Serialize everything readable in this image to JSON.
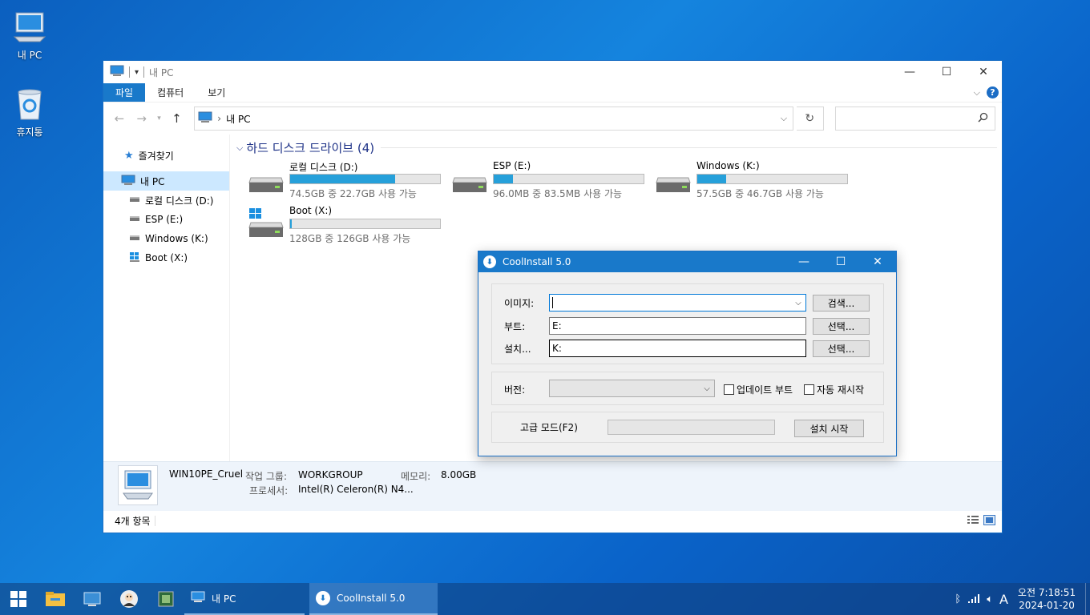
{
  "desktop": {
    "icons": [
      {
        "label": "내 PC",
        "icon": "computer-icon"
      },
      {
        "label": "휴지통",
        "icon": "recycle-bin-icon"
      }
    ]
  },
  "explorer": {
    "title": "내 PC",
    "ribbon_tabs": [
      "파일",
      "컴퓨터",
      "보기"
    ],
    "address": "내 PC",
    "search_placeholder": "",
    "nav": {
      "favorites": "즐겨찾기",
      "this_pc": "내 PC",
      "drives": [
        "로컬 디스크 (D:)",
        "ESP (E:)",
        "Windows (K:)",
        "Boot (X:)"
      ]
    },
    "group_title": "하드 디스크 드라이브 (4)",
    "drives": [
      {
        "name": "로컬 디스크 (D:)",
        "free_text": "74.5GB 중 22.7GB 사용 가능",
        "used_fraction": 0.7
      },
      {
        "name": "ESP (E:)",
        "free_text": "96.0MB 중 83.5MB 사용 가능",
        "used_fraction": 0.13
      },
      {
        "name": "Windows (K:)",
        "free_text": "57.5GB 중 46.7GB 사용 가능",
        "used_fraction": 0.19
      },
      {
        "name": "Boot (X:)",
        "free_text": "128GB 중 126GB 사용 가능",
        "used_fraction": 0.01
      }
    ],
    "details": {
      "pc_name": "WIN10PE_Cruel",
      "workgroup_label": "작업 그룹:",
      "workgroup_value": "WORKGROUP",
      "memory_label": "메모리:",
      "memory_value": "8.00GB",
      "processor_label": "프로세서:",
      "processor_value": "Intel(R) Celeron(R) N4..."
    },
    "status": "4개 항목"
  },
  "dialog": {
    "title": "CoolInstall 5.0",
    "image_label": "이미지:",
    "image_value": "",
    "browse_button": "검색...",
    "boot_label": "부트:",
    "boot_value": "E:",
    "install_label": "설치...",
    "install_value": "K:",
    "select_button": "선택...",
    "version_label": "버전:",
    "version_value": "",
    "update_boot": "업데이트 부트",
    "auto_restart": "자동 재시작",
    "advanced_mode": "고급 모드(F2)",
    "start_button": "설치 시작"
  },
  "taskbar": {
    "apps": [
      {
        "label": "내 PC",
        "active": false
      },
      {
        "label": "CoolInstall 5.0",
        "active": true
      }
    ],
    "ime": "A",
    "time": "오전 7:18:51",
    "date": "2024-01-20"
  }
}
